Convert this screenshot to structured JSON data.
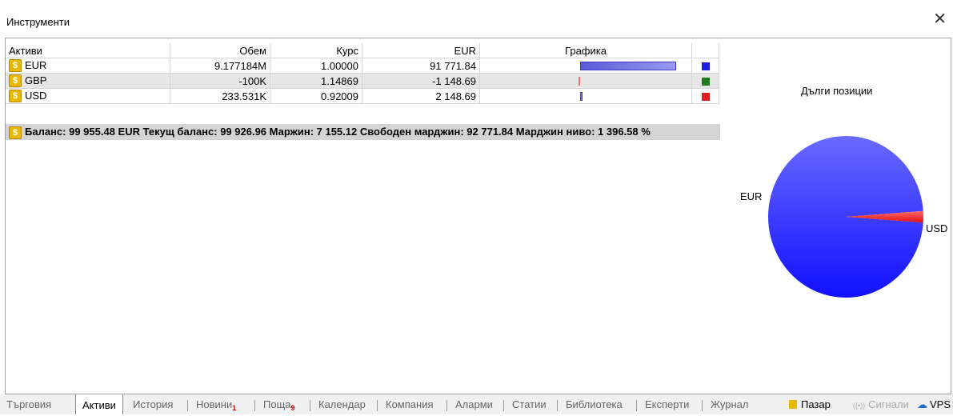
{
  "window": {
    "title": "Инструменти",
    "close_icon": "close-icon"
  },
  "table": {
    "headers": {
      "name": "Активи",
      "volume": "Обем",
      "rate": "Курс",
      "eur": "EUR",
      "graph": "Графика"
    },
    "rows": [
      {
        "name": "EUR",
        "volume": "9.177184M",
        "rate": "1.00000",
        "eur": "91 771.84",
        "color": "#1f1fe0",
        "share": 0.92
      },
      {
        "name": "GBP",
        "volume": "-100K",
        "rate": "1.14869",
        "eur": "-1 148.69",
        "color": "#1f7a1f",
        "share": -0.012
      },
      {
        "name": "USD",
        "volume": "233.531K",
        "rate": "0.92009",
        "eur": "2 148.69",
        "color": "#e02020",
        "share": 0.022
      }
    ],
    "summary": "Баланс: 99 955.48 EUR  Текущ баланс: 99 926.96  Маржин: 7 155.12  Свободен марджин: 92 771.84  Марджин ниво: 1 396.58 %"
  },
  "pie": {
    "title": "Дълги позиции",
    "slices": [
      {
        "label": "EUR",
        "value": 91771.84,
        "color": "#3030ff"
      },
      {
        "label": "USD",
        "value": 2148.69,
        "color": "#ff3030"
      }
    ]
  },
  "tabs": {
    "items": [
      "Търговия",
      "Активи",
      "История",
      "Новини",
      "Поща",
      "Календар",
      "Компания",
      "Аларми",
      "Статии",
      "Библиотека",
      "Експерти",
      "Журнал"
    ],
    "active": "Активи",
    "news_badge": "1",
    "mail_badge": "9",
    "market": "Пазар",
    "signals": "Сигнали",
    "vps": "VPS"
  }
}
